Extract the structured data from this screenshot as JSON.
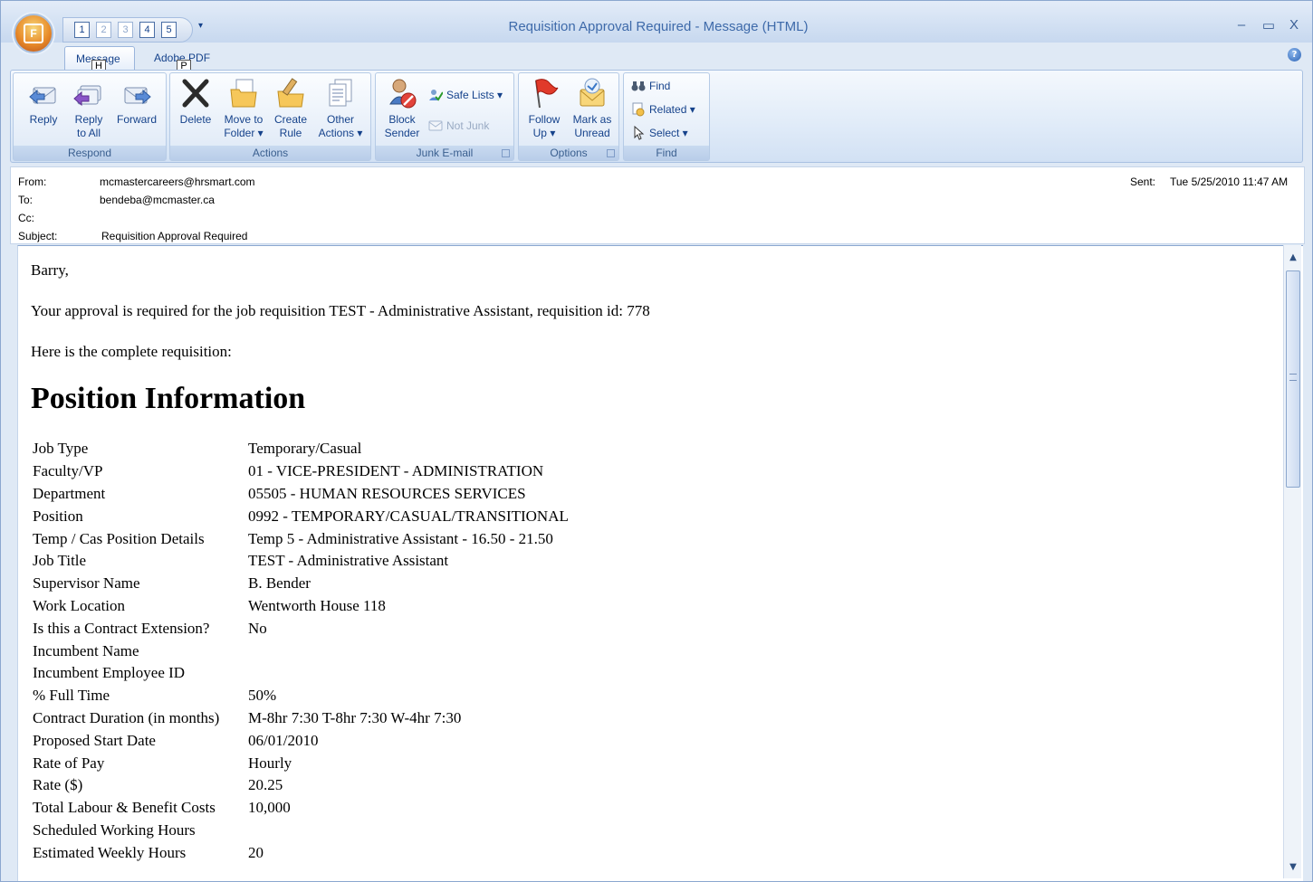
{
  "window": {
    "title": "Requisition Approval Required - Message (HTML)",
    "minimize": "–",
    "maximize": "▭",
    "close": "X"
  },
  "qat": {
    "orb_letter": "F",
    "keys": [
      "1",
      "2",
      "3",
      "4",
      "5"
    ],
    "dropdown": "▾"
  },
  "tabs": [
    {
      "label": "Message",
      "keytip": "H"
    },
    {
      "label": "Adobe PDF",
      "keytip": "P"
    }
  ],
  "help": "?",
  "ribbon": {
    "respond": {
      "label": "Respond",
      "reply": "Reply",
      "reply_all_1": "Reply",
      "reply_all_2": "to All",
      "forward": "Forward"
    },
    "actions": {
      "label": "Actions",
      "delete": "Delete",
      "move_1": "Move to",
      "move_2": "Folder ▾",
      "create_1": "Create",
      "create_2": "Rule",
      "other_1": "Other",
      "other_2": "Actions ▾"
    },
    "junk": {
      "label": "Junk E-mail",
      "block_1": "Block",
      "block_2": "Sender",
      "safe_lists": "Safe Lists ▾",
      "not_junk": "Not Junk"
    },
    "options": {
      "label": "Options",
      "follow_1": "Follow",
      "follow_2": "Up ▾",
      "mark_1": "Mark as",
      "mark_2": "Unread"
    },
    "find": {
      "label": "Find",
      "find": "Find",
      "related": "Related ▾",
      "select": "Select ▾"
    }
  },
  "header": {
    "from_label": "From:",
    "from": "mcmastercareers@hrsmart.com",
    "to_label": "To:",
    "to": "bendeba@mcmaster.ca",
    "cc_label": "Cc:",
    "subject_label": "Subject:",
    "subject": "Requisition Approval Required",
    "sent_label": "Sent:",
    "sent": "Tue 5/25/2010 11:47 AM"
  },
  "message": {
    "greeting": "Barry,",
    "line1": "Your approval is required for the job requisition TEST - Administrative Assistant, requisition id: 778",
    "line2": "Here is the complete requisition:",
    "heading": "Position Information",
    "rows": [
      {
        "label": "Job Type",
        "value": "Temporary/Casual"
      },
      {
        "label": "Faculty/VP",
        "value": "01 - VICE-PRESIDENT - ADMINISTRATION"
      },
      {
        "label": "Department",
        "value": "05505 - HUMAN RESOURCES SERVICES"
      },
      {
        "label": "Position",
        "value": "0992 - TEMPORARY/CASUAL/TRANSITIONAL"
      },
      {
        "label": "Temp / Cas Position Details",
        "value": "Temp 5 - Administrative Assistant - 16.50 - 21.50"
      },
      {
        "label": "Job Title",
        "value": "TEST - Administrative Assistant"
      },
      {
        "label": "Supervisor Name",
        "value": "B. Bender"
      },
      {
        "label": "Work Location",
        "value": "Wentworth House 118"
      },
      {
        "label": "Is this a Contract Extension?",
        "value": "No"
      },
      {
        "label": "Incumbent Name",
        "value": ""
      },
      {
        "label": "Incumbent Employee ID",
        "value": ""
      },
      {
        "label": "% Full Time",
        "value": "50%"
      },
      {
        "label": "Contract Duration (in months)",
        "value": "M-8hr 7:30 T-8hr 7:30 W-4hr 7:30"
      },
      {
        "label": "Proposed Start Date",
        "value": "06/01/2010"
      },
      {
        "label": "Rate of Pay",
        "value": "Hourly"
      },
      {
        "label": "Rate ($)",
        "value": "20.25"
      },
      {
        "label": "Total Labour & Benefit Costs",
        "value": "10,000"
      },
      {
        "label": "Scheduled Working Hours",
        "value": ""
      },
      {
        "label": "Estimated Weekly Hours",
        "value": "20"
      }
    ]
  }
}
